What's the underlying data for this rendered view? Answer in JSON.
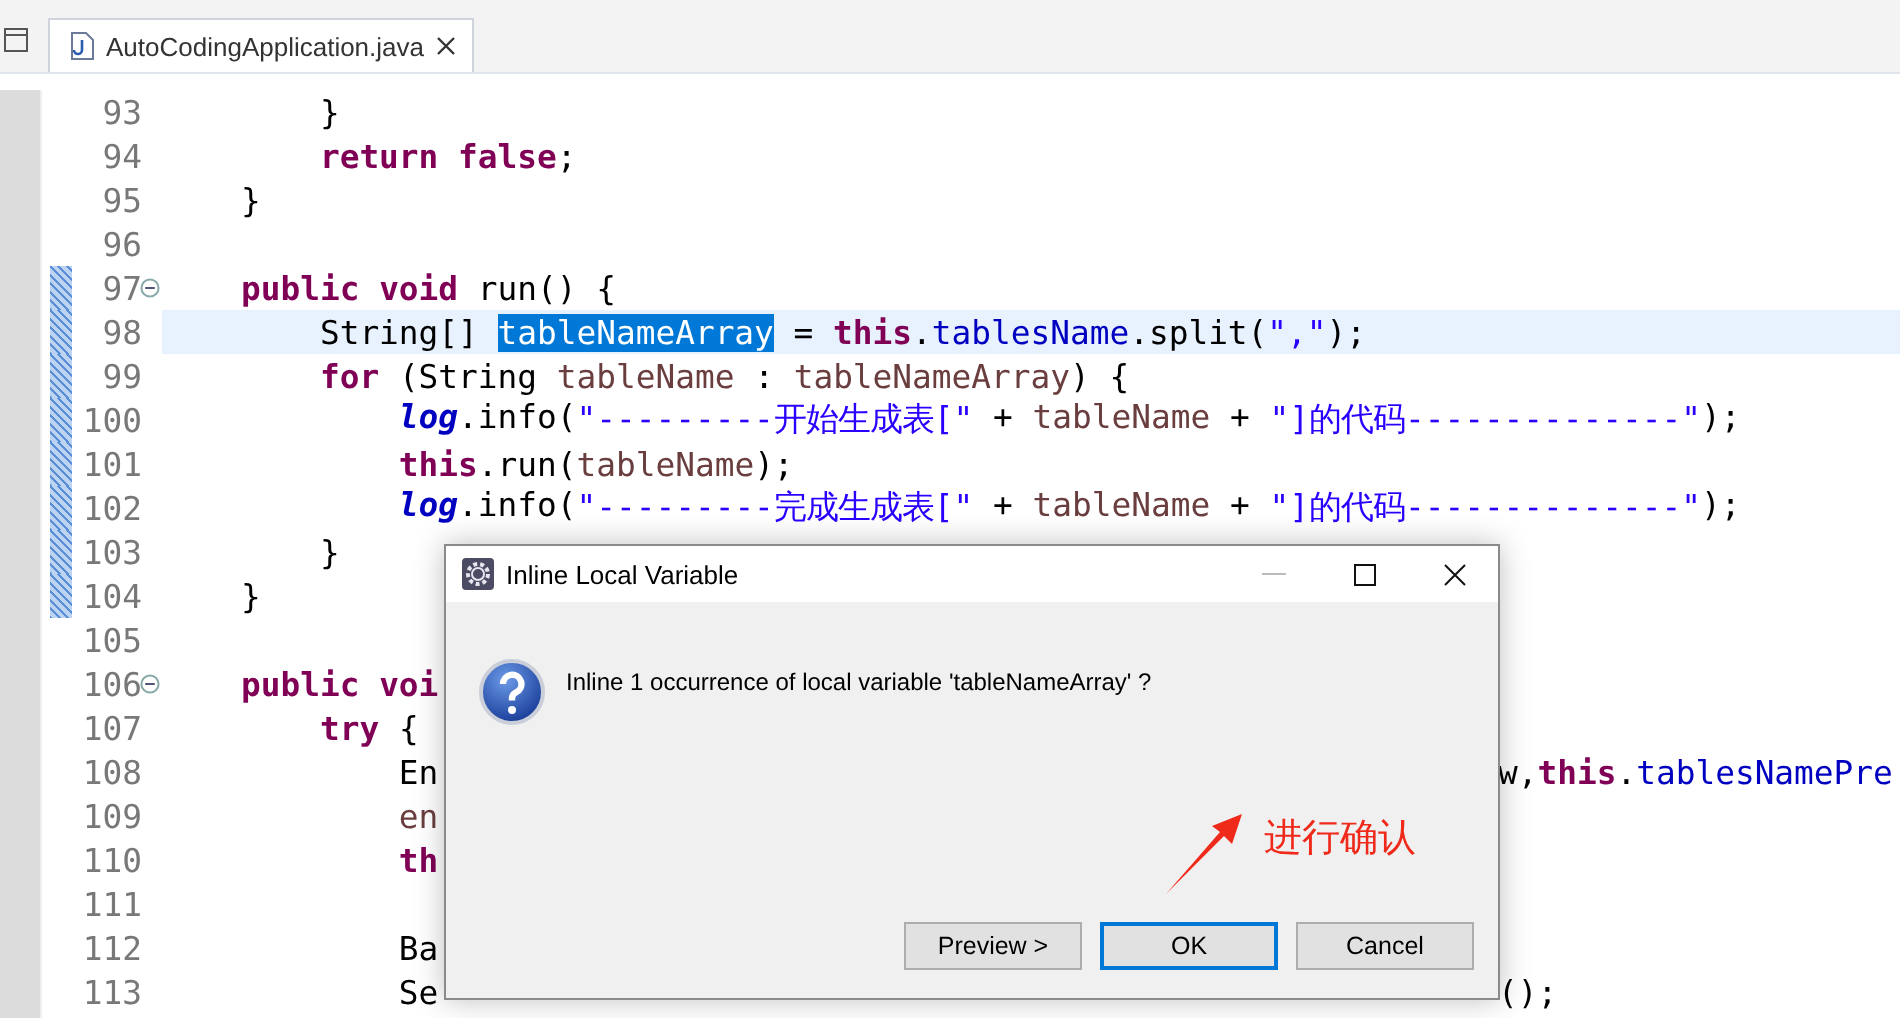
{
  "editor_tab": {
    "title": "AutoCodingApplication.java",
    "selected": true
  },
  "lines": [
    {
      "number": "93",
      "tokens": [
        {
          "t": "        }",
          "kind": "plain"
        }
      ]
    },
    {
      "number": "94",
      "tokens": [
        {
          "t": "        return ",
          "kind": "kw"
        },
        {
          "t": "false",
          "kind": "kw"
        },
        {
          "t": ";",
          "kind": "plain"
        }
      ]
    },
    {
      "number": "95",
      "tokens": [
        {
          "t": "    }",
          "kind": "plain"
        }
      ]
    },
    {
      "number": "96"
    },
    {
      "number": "97",
      "fold": true,
      "changed": true,
      "tokens": [
        {
          "t": "    public ",
          "kind": "kw"
        },
        {
          "t": "void",
          "kind": "kw"
        },
        {
          "t": " run() {",
          "kind": "plain"
        }
      ]
    },
    {
      "number": "98",
      "current": true,
      "changed": true,
      "tokens": [
        {
          "t": "        String[] ",
          "kind": "plain"
        },
        {
          "t": "tableNameArray",
          "kind": "sel"
        },
        {
          "t": " = ",
          "kind": "plain"
        },
        {
          "t": "this",
          "kind": "kw"
        },
        {
          "t": ".",
          "kind": "plain"
        },
        {
          "t": "tablesName",
          "kind": "field"
        },
        {
          "t": ".split(",
          "kind": "plain"
        },
        {
          "t": "\",\"",
          "kind": "str"
        },
        {
          "t": ");",
          "kind": "plain"
        }
      ]
    },
    {
      "number": "99",
      "changed": true,
      "tokens": [
        {
          "t": "        for",
          "kind": "kw"
        },
        {
          "t": " (String ",
          "kind": "plain"
        },
        {
          "t": "tableName",
          "kind": "local"
        },
        {
          "t": " : ",
          "kind": "plain"
        },
        {
          "t": "tableNameArray",
          "kind": "local"
        },
        {
          "t": ") {",
          "kind": "plain"
        }
      ]
    },
    {
      "number": "100",
      "changed": true,
      "tokens": [
        {
          "t": "            log",
          "kind": "static"
        },
        {
          "t": ".info(",
          "kind": "plain"
        },
        {
          "t": "\"---------开始生成表[\"",
          "kind": "str"
        },
        {
          "t": " + ",
          "kind": "plain"
        },
        {
          "t": "tableName",
          "kind": "local"
        },
        {
          "t": " + ",
          "kind": "plain"
        },
        {
          "t": "\"]的代码--------------\"",
          "kind": "str"
        },
        {
          "t": ");",
          "kind": "plain"
        }
      ]
    },
    {
      "number": "101",
      "changed": true,
      "tokens": [
        {
          "t": "            this",
          "kind": "kw"
        },
        {
          "t": ".run(",
          "kind": "plain"
        },
        {
          "t": "tableName",
          "kind": "local"
        },
        {
          "t": ");",
          "kind": "plain"
        }
      ]
    },
    {
      "number": "102",
      "changed": true,
      "tokens": [
        {
          "t": "            log",
          "kind": "static"
        },
        {
          "t": ".info(",
          "kind": "plain"
        },
        {
          "t": "\"---------完成生成表[\"",
          "kind": "str"
        },
        {
          "t": " + ",
          "kind": "plain"
        },
        {
          "t": "tableName",
          "kind": "local"
        },
        {
          "t": " + ",
          "kind": "plain"
        },
        {
          "t": "\"]的代码--------------\"",
          "kind": "str"
        },
        {
          "t": ");",
          "kind": "plain"
        }
      ]
    },
    {
      "number": "103",
      "changed": true,
      "tokens": [
        {
          "t": "        }",
          "kind": "plain"
        }
      ]
    },
    {
      "number": "104",
      "changed": true,
      "tokens": [
        {
          "t": "    }",
          "kind": "plain"
        }
      ]
    },
    {
      "number": "105"
    },
    {
      "number": "106",
      "fold": true,
      "tokens": [
        {
          "t": "    public ",
          "kind": "kw"
        },
        {
          "t": "voi",
          "kind": "kw"
        }
      ]
    },
    {
      "number": "107",
      "tokens": [
        {
          "t": "        try",
          "kind": "kw"
        },
        {
          "t": " {",
          "kind": "plain"
        }
      ]
    },
    {
      "number": "108",
      "tokens": [
        {
          "t": "            En",
          "kind": "plain"
        }
      ],
      "right": [
        {
          "t": "w,",
          "kind": "plain"
        },
        {
          "t": "this",
          "kind": "kw"
        },
        {
          "t": ".",
          "kind": "plain"
        },
        {
          "t": "tablesNamePre",
          "kind": "field"
        }
      ]
    },
    {
      "number": "109",
      "tokens": [
        {
          "t": "            en",
          "kind": "local"
        }
      ]
    },
    {
      "number": "110",
      "tokens": [
        {
          "t": "            th",
          "kind": "kw"
        }
      ]
    },
    {
      "number": "111"
    },
    {
      "number": "112",
      "tokens": [
        {
          "t": "            Ba",
          "kind": "plain"
        }
      ]
    },
    {
      "number": "113",
      "tokens": [
        {
          "t": "            Se",
          "kind": "plain"
        }
      ],
      "right": [
        {
          "t": "();",
          "kind": "plain"
        }
      ]
    }
  ],
  "dialog": {
    "title": "Inline Local Variable",
    "message": "Inline 1 occurrence of local variable 'tableNameArray' ?",
    "buttons": [
      {
        "label": "Preview >",
        "selected": false
      },
      {
        "label": "OK",
        "selected": true
      },
      {
        "label": "Cancel",
        "selected": false
      }
    ]
  },
  "annotation": {
    "text": "进行确认"
  }
}
